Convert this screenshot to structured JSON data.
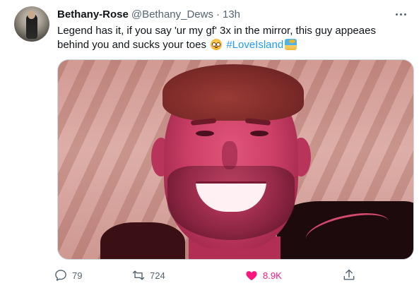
{
  "tweet": {
    "author_name": "Bethany-Rose",
    "author_handle": "@Bethany_Dews",
    "separator": "·",
    "time": "13h",
    "text_main": "Legend has it, if you say 'ur my gf' 3x in the mirror, this guy appeaes behind you and sucks your toes",
    "hashtag": "#LoveIsland",
    "emojis": [
      "flushed-face",
      "desert-island"
    ],
    "stats": {
      "replies": "79",
      "retweets": "724",
      "likes": "8.9K"
    },
    "like_color": "#f91880",
    "link_color": "#1d9bf0"
  }
}
